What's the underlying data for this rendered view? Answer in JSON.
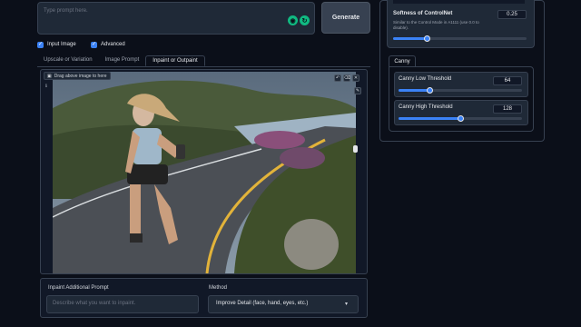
{
  "prompt": {
    "placeholder": "Type prompt here."
  },
  "generate_label": "Generate",
  "checkboxes": [
    {
      "label": "Input Image",
      "checked": true
    },
    {
      "label": "Advanced",
      "checked": true
    }
  ],
  "tabs": [
    {
      "label": "Upscale or Variation",
      "active": false
    },
    {
      "label": "Image Prompt",
      "active": false
    },
    {
      "label": "Inpaint or Outpaint",
      "active": true
    }
  ],
  "image_panel": {
    "drag_label": "Drag above image to here",
    "tool_icons": [
      "undo-icon",
      "clear-icon",
      "close-icon"
    ],
    "pencil_icon": "pencil-icon"
  },
  "inpaint": {
    "prompt_label": "Inpaint Additional Prompt",
    "prompt_placeholder": "Describe what you want to inpaint.",
    "method_label": "Method",
    "method_value": "Improve Detail (face, hand, eyes, etc.)"
  },
  "controlnet": {
    "softness_label": "Softness of ControlNet",
    "softness_desc": "Similar to the Control Mode in A1111 (use 0.0 to disable).",
    "softness_value": "0.25",
    "softness_fraction": 0.25
  },
  "canny": {
    "tab_label": "Canny",
    "low_label": "Canny Low Threshold",
    "low_value": "64",
    "low_fraction": 0.25,
    "high_label": "Canny High Threshold",
    "high_value": "128",
    "high_fraction": 0.5
  },
  "colors": {
    "accent": "#3b82f6",
    "background": "#0b0f19",
    "panel": "#1f2937"
  }
}
